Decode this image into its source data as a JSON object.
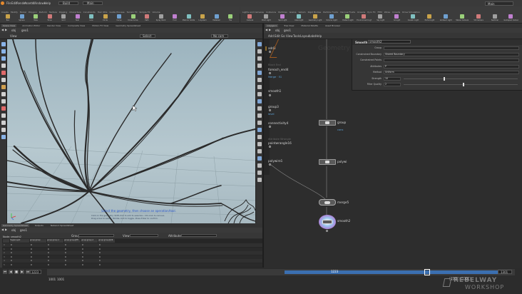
{
  "menu": [
    "File",
    "Edit",
    "Render",
    "Assets",
    "Windows",
    "Help"
  ],
  "build_desktop": "Build",
  "main_dropdown": "Main",
  "shelf_tabs_left": [
    "Create",
    "Modify",
    "Model",
    "Polygon",
    "Deform",
    "Texture",
    "Rigging",
    "Characters",
    "Constraints",
    "Hair Utils",
    "Guide Process",
    "Terrain FX",
    "Simple FX",
    "Volume"
  ],
  "shelf_tabs_right": [
    "Lights and Cameras",
    "Collisions",
    "Particles",
    "Grains",
    "Vellum",
    "Rigid Bodies",
    "Particle Fluids",
    "Viscous Fluids",
    "Oceans",
    "Pyro FX",
    "FEM",
    "Wires",
    "Crowds",
    "Drive Simulation"
  ],
  "shelf_tools_left": [
    "Box",
    "Sphere",
    "Tube",
    "Torus",
    "Grid",
    "Null",
    "Line",
    "Circle",
    "Curve",
    "Draw Curve",
    "Path",
    "Spray Paint",
    "Font",
    "Platonic Solids",
    "L-System",
    "Metaball",
    "File"
  ],
  "shelf_tools_right": [
    "Camera",
    "Point Light",
    "Spot Light",
    "Area Light",
    "Geometry Light",
    "Volume Light",
    "Distant Light",
    "Environment Light",
    "Sky Light",
    "GI Light",
    "Caustic Light",
    "Portal Light",
    "Ambient Light",
    "Stereo Camera",
    "VR Camera",
    "Switcher",
    "Gamepad Camera"
  ],
  "right_top_dropdown": "Main",
  "viewport_tabs": [
    "Scene View",
    "Animation Editor",
    "Render View",
    "Composite View",
    "Motion FX View",
    "Geometry Spreadsheet"
  ],
  "network_tabs": [
    "/obj/geo1",
    "Tree View",
    "Material Palette",
    "Asset Browser"
  ],
  "network_path": [
    "obj",
    "geo1"
  ],
  "network_menu": [
    "Add",
    "Edit",
    "Go",
    "View",
    "Tools",
    "Layout",
    "Labs",
    "Help"
  ],
  "viewport_path": [
    "obj",
    "geo1"
  ],
  "viewport_mode": "View",
  "viewport_dropdown": "Select",
  "viewport_camera": "No cam",
  "viewport_notice": "Select the geometry, then choose an operation/tool.",
  "viewport_hint_lines": [
    "Click on the geometry. Shift-click to add to selection. Ctrl-click to remove.",
    "Drag a box to select. Middle-click to toggle. Press Enter to confirm."
  ],
  "geometry_watermark": "Geometry",
  "nodes": {
    "add3": "add3",
    "foreach_end4": "foreach_end4",
    "foreach_sub": "Merge · 51",
    "foreach_top": "Block End",
    "smooth1": "smooth1",
    "group3": "group3",
    "group3_sub": "level",
    "connectivity4": "connectivity4",
    "attrib_top": "Attribute Wrangle",
    "pointwrangle16": "pointwrangle16",
    "polywire1": "polywire1",
    "group_r": "group",
    "group_r_sub": "cons",
    "polywire_r": "polywi",
    "merge5": "merge5",
    "smooth2": "smooth2"
  },
  "params": {
    "header_type": "Smooth",
    "header_name": "smooth2",
    "rows": [
      {
        "label": "Group",
        "value": ""
      },
      {
        "label": "Constrained Boundary",
        "value": "Shared Boundary"
      },
      {
        "label": "Constrained Points",
        "value": ""
      },
      {
        "label": "Attributes",
        "value": "P"
      },
      {
        "label": "Method",
        "value": "Uniform"
      },
      {
        "label": "Strength",
        "value": "10"
      },
      {
        "label": "Filter Quality",
        "value": "2"
      }
    ],
    "slider_strength": 0.35,
    "slider_quality": 0.52
  },
  "spreadsheet": {
    "tabs": [
      "Geometry Spreadsheet",
      "Outputs",
      "Network Spreadsheet"
    ],
    "path": [
      "obj",
      "geo1"
    ],
    "node_label": "Node: smooth2",
    "group_label": "Group:",
    "view_label": "View",
    "attrib_label": "Attributes",
    "columns": [
      "",
      "fragGroupId",
      "group:group",
      "group:group.1",
      "group:group@FR",
      "group:group.2",
      "group:group@XR"
    ],
    "rows": [
      [
        "0",
        "0",
        "0",
        "0",
        "0",
        "0",
        "0"
      ],
      [
        "1",
        "0",
        "0",
        "0",
        "0",
        "0",
        "0"
      ],
      [
        "2",
        "0",
        "0",
        "0",
        "0",
        "0",
        "0"
      ],
      [
        "3",
        "0",
        "0",
        "0",
        "0",
        "0",
        "0"
      ],
      [
        "4",
        "0",
        "0",
        "0",
        "0",
        "0",
        "0"
      ],
      [
        "5",
        "0",
        "0",
        "0",
        "0",
        "0",
        "0"
      ]
    ]
  },
  "timeline": {
    "frame": "1223",
    "start": "1001",
    "end": "1001",
    "range_start": "1001",
    "range_end": "1301",
    "marker": "1223",
    "end_field": "1301",
    "playhead_fraction": 0.2
  },
  "brand": {
    "line1": "REBELWAY",
    "line2": "WORKSHOP"
  },
  "colors": {
    "accent": "#3b9be8",
    "node_selected": "#4f94d4",
    "tree_stroke": "#2a2a2a",
    "viewport_sky": "#a8bfc9"
  }
}
